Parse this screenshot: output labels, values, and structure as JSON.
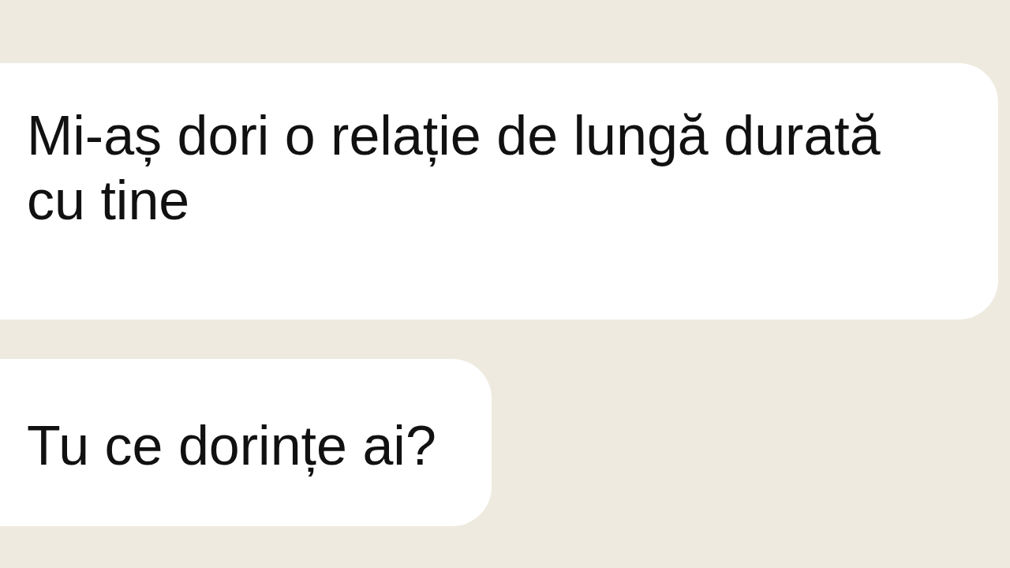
{
  "messages": [
    {
      "text": "Mi-aș dori o relație de lungă durată cu tine"
    },
    {
      "text": "Tu ce dorințe ai?"
    }
  ]
}
